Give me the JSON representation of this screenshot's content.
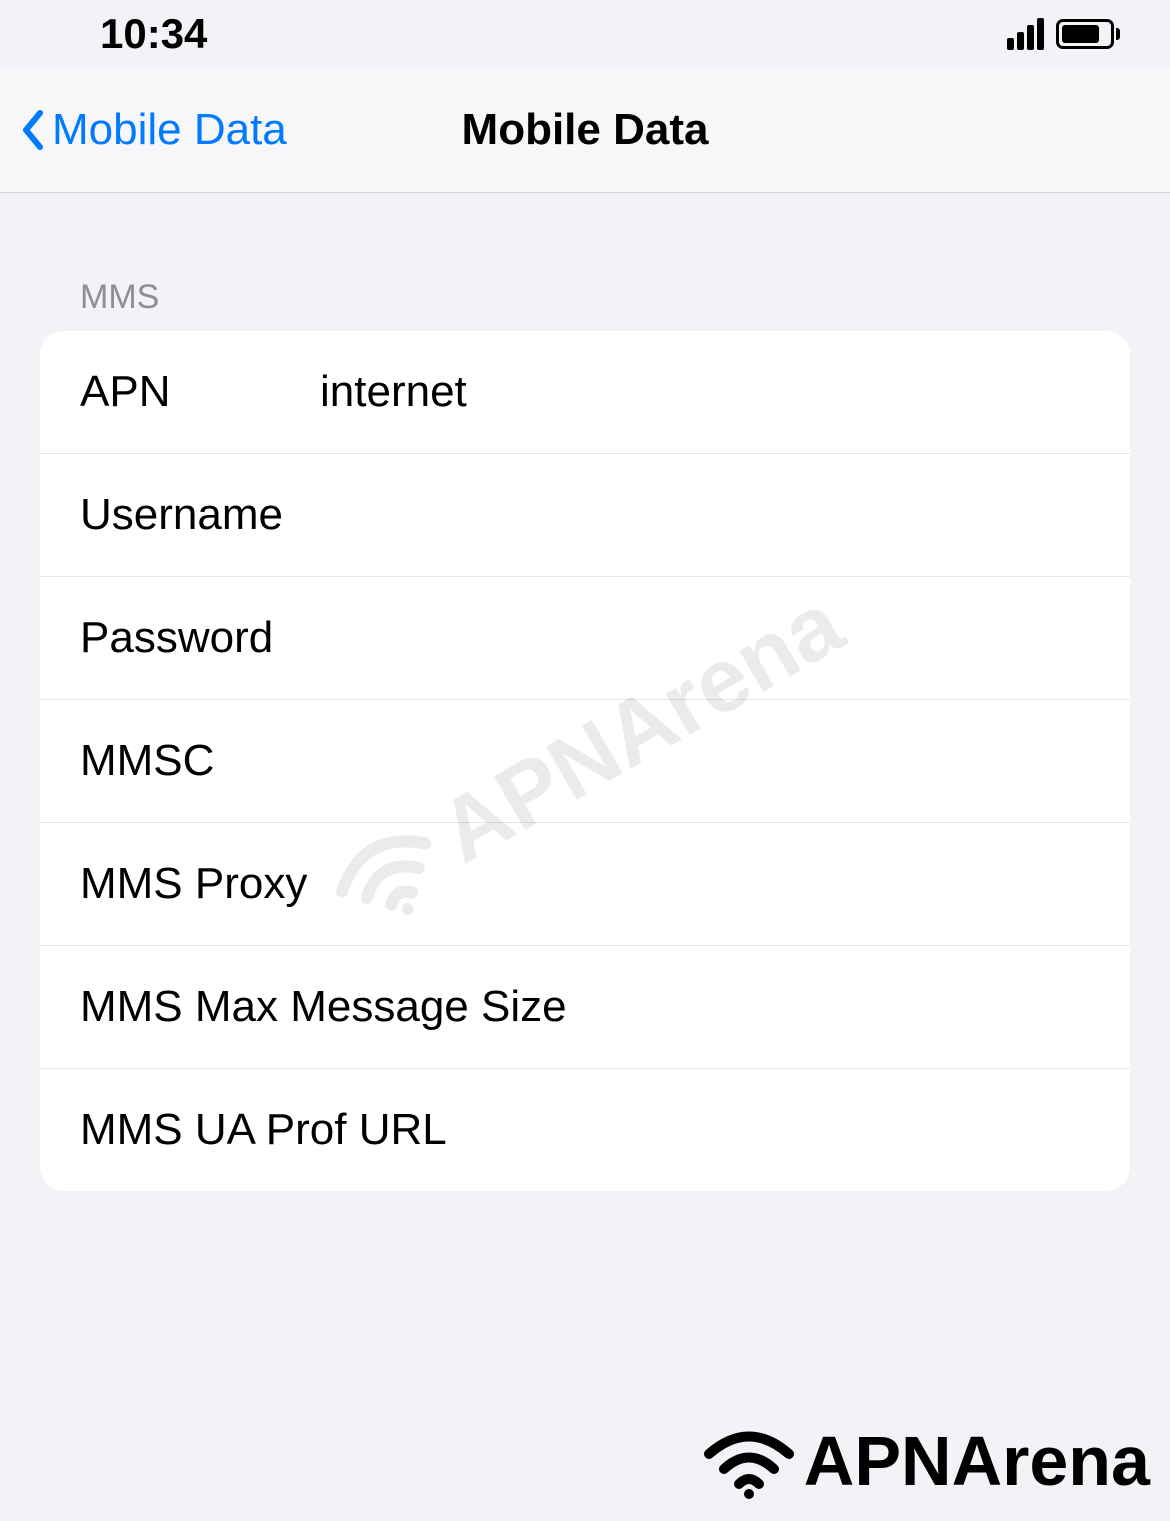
{
  "status_bar": {
    "time": "10:34"
  },
  "nav": {
    "back_label": "Mobile Data",
    "title": "Mobile Data"
  },
  "section": {
    "header": "MMS",
    "rows": [
      {
        "label": "APN",
        "value": "internet"
      },
      {
        "label": "Username",
        "value": ""
      },
      {
        "label": "Password",
        "value": ""
      },
      {
        "label": "MMSC",
        "value": ""
      },
      {
        "label": "MMS Proxy",
        "value": ""
      },
      {
        "label": "MMS Max Message Size",
        "value": ""
      },
      {
        "label": "MMS UA Prof URL",
        "value": ""
      }
    ]
  },
  "watermark": {
    "text": "APNArena"
  },
  "brand": {
    "text": "APNArena"
  }
}
